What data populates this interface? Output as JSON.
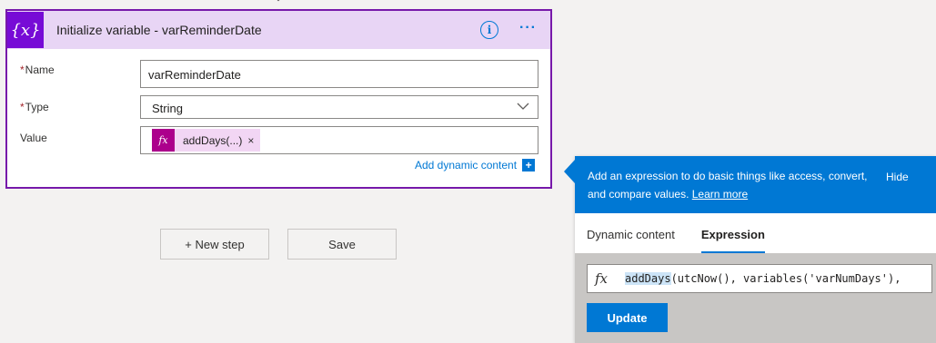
{
  "card": {
    "icon_glyph": "{x}",
    "title": "Initialize variable - varReminderDate",
    "info_glyph": "i",
    "more_glyph": "···",
    "name_required": "*",
    "name_label": "Name",
    "name_value": "varReminderDate",
    "type_required": "*",
    "type_label": "Type",
    "type_value": "String",
    "value_label": "Value",
    "token": {
      "icon": "fx",
      "label": "addDays(...)",
      "close": "×"
    },
    "add_dynamic_label": "Add dynamic content",
    "add_dynamic_plus": "+"
  },
  "actions": {
    "new_step_label": "+ New step",
    "save_label": "Save"
  },
  "panel": {
    "banner_text": "Add an expression to do basic things like access, convert, and compare values.",
    "learn_more": "Learn more",
    "hide_label": "Hide",
    "tabs": [
      {
        "label": "Dynamic content",
        "active": false
      },
      {
        "label": "Expression",
        "active": true
      }
    ],
    "expression_fx": "fx",
    "expression_fn": "addDays",
    "expression_rest": "(utcNow(), variables('varNumDays'),",
    "update_label": "Update"
  },
  "colors": {
    "accent": "#0078d4",
    "card_border": "#7719aa",
    "card_header_bg": "#e8d5f5",
    "token_bg": "#f2d6f4",
    "token_icon_bg": "#ac008c"
  },
  "icons": [
    "variable-icon",
    "info-icon",
    "more-icon",
    "chevron-down-icon",
    "fx-icon",
    "close-icon",
    "plus-icon"
  ]
}
